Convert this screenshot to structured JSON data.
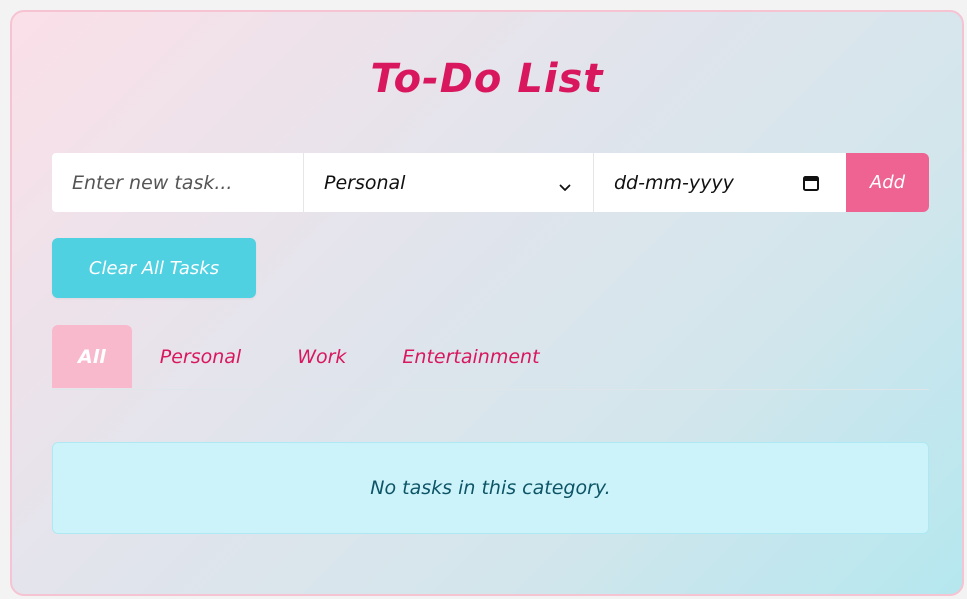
{
  "app": {
    "title": "To-Do List"
  },
  "form": {
    "task_placeholder": "Enter new task...",
    "task_value": "",
    "category_selected": "Personal",
    "category_options": [
      "Personal",
      "Work",
      "Entertainment"
    ],
    "date_placeholder": "dd-mm-yyyy",
    "add_label": "Add"
  },
  "actions": {
    "clear_label": "Clear All Tasks"
  },
  "tabs": [
    {
      "label": "All",
      "active": true
    },
    {
      "label": "Personal",
      "active": false
    },
    {
      "label": "Work",
      "active": false
    },
    {
      "label": "Entertainment",
      "active": false
    }
  ],
  "list": {
    "empty_message": "No tasks in this category."
  },
  "colors": {
    "accent_pink": "#d8175f",
    "add_button": "#ee6392",
    "clear_button": "#4fd1e2",
    "active_tab": "#f8b9cd",
    "empty_bg": "#cdf3fa"
  },
  "icons": {
    "select_chevron": "chevron-down-icon",
    "date_picker": "calendar-icon"
  }
}
